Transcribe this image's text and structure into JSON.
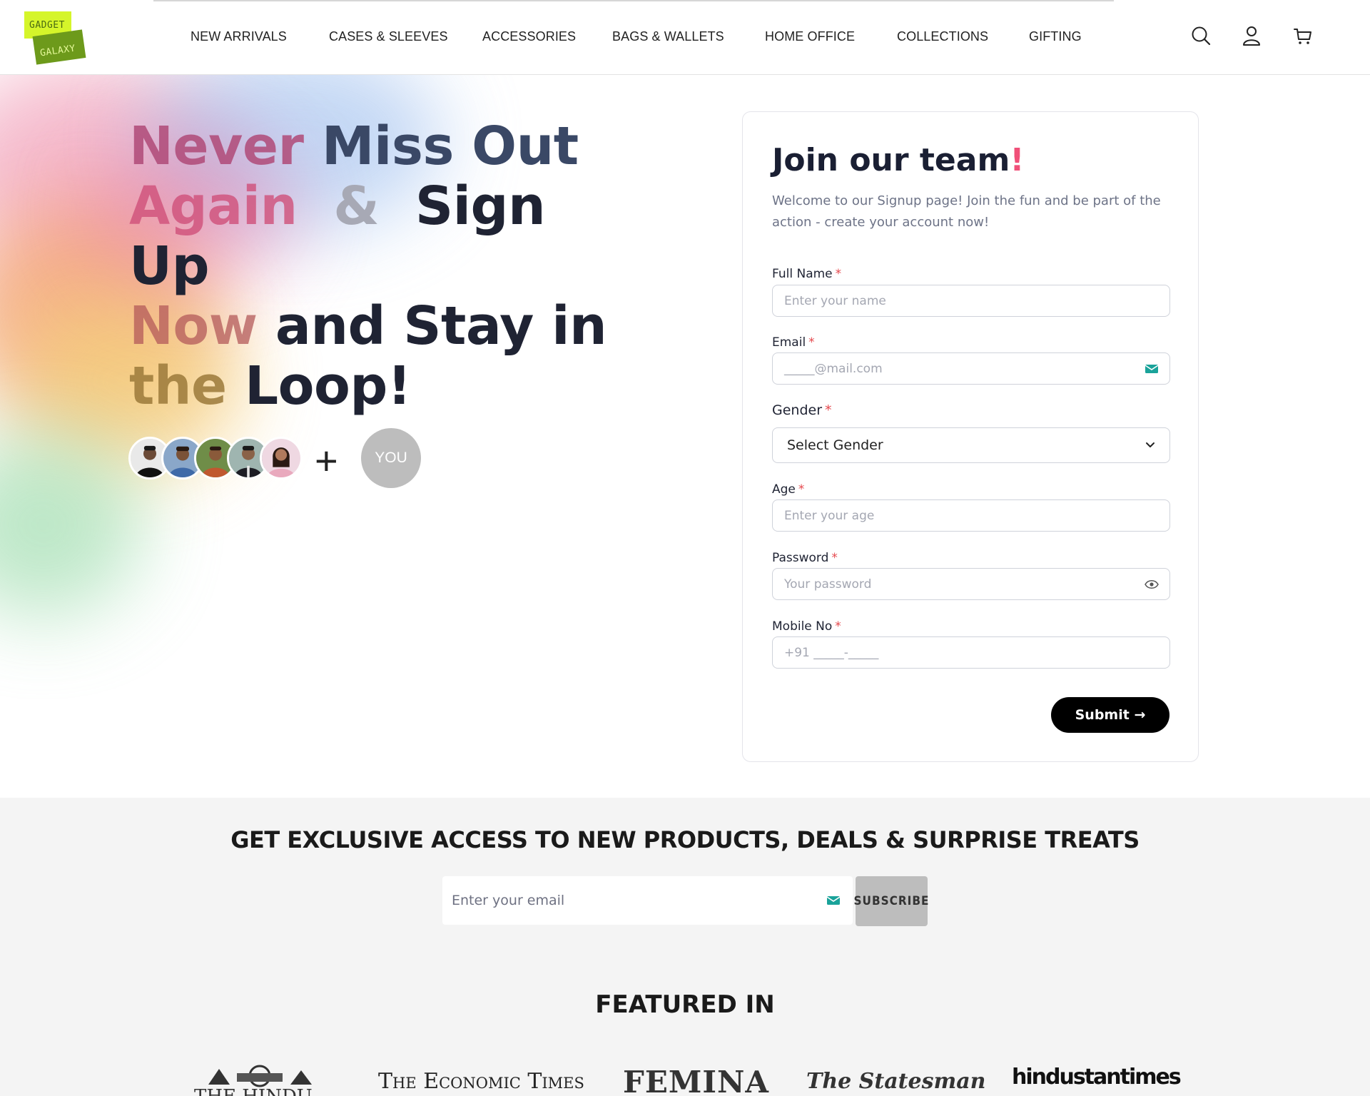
{
  "header": {
    "logo": {
      "line1": "GADGET",
      "line2": "GALAXY"
    },
    "nav": [
      "NEW ARRIVALS",
      "CASES & SLEEVES",
      "ACCESSORIES",
      "BAGS & WALLETS",
      "HOME OFFICE",
      "COLLECTIONS",
      "GIFTING"
    ],
    "icons": [
      "search-icon",
      "user-icon",
      "cart-icon"
    ]
  },
  "hero": {
    "headline": {
      "w1": "Never",
      "w2": "Miss Out",
      "w3": "Again",
      "amp": "&",
      "w4": "Sign Up",
      "w5": "Now",
      "w6": "and Stay in",
      "w7": "the",
      "w8": "Loop!"
    },
    "avatars_count": 5,
    "plus": "+",
    "you_label": "YOU"
  },
  "form": {
    "title": "Join our team",
    "title_accent": "!",
    "subtitle": "Welcome to our Signup page! Join the fun and be part of the action - create your account now!",
    "required_mark": "*",
    "full_name": {
      "label": "Full Name",
      "placeholder": "Enter your name"
    },
    "email": {
      "label": "Email",
      "placeholder": "_____@mail.com"
    },
    "gender": {
      "label": "Gender",
      "value": "Select Gender"
    },
    "age": {
      "label": "Age",
      "placeholder": "Enter your age"
    },
    "password": {
      "label": "Password",
      "placeholder": "Your password"
    },
    "mobile": {
      "label": "Mobile No",
      "placeholder": "+91 _____-_____"
    },
    "submit_label": "Submit →",
    "accent_color": "#f05079"
  },
  "newsletter": {
    "title": "GET EXCLUSIVE ACCESS TO NEW PRODUCTS, DEALS & SURPRISE TREATS",
    "email_placeholder": "Enter your email",
    "subscribe_label": "SUBSCRIBE"
  },
  "featured": {
    "title": "FEATURED IN",
    "logos": [
      "THE HINDU",
      "The Economic Times",
      "FEMINA",
      "The Statesman",
      "hindustantimes"
    ]
  }
}
